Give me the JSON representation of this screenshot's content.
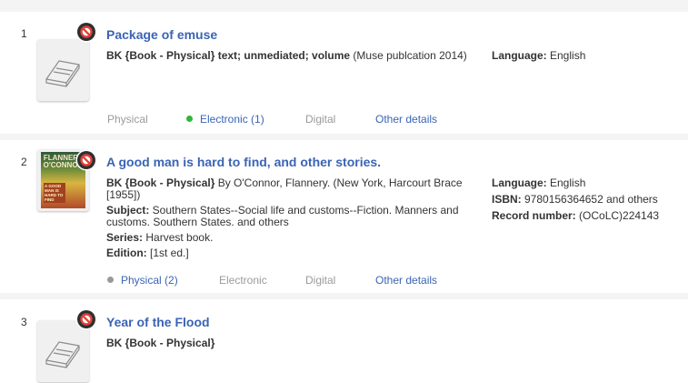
{
  "colors": {
    "link": "#3a64b4",
    "available_green": "#2db83d",
    "unavailable_grey": "#9a9a9a",
    "badge_bg": "#2f2f2f",
    "badge_ring": "#e0413a"
  },
  "results": [
    {
      "number": "1",
      "icon": "book-placeholder-icon",
      "title": "Package of emuse",
      "type_label": "BK {Book - Physical}",
      "type_rest": " text; unmediated; volume",
      "publication": " (Muse publcation 2014)",
      "language_label": "Language:",
      "language_value": " English",
      "tabs": {
        "physical": "Physical",
        "electronic": "Electronic (1)",
        "digital": "Digital",
        "other": "Other details"
      }
    },
    {
      "number": "2",
      "cover_title": "FLANNERY O'CONNOR",
      "cover_subtitle": "A GOOD MAN IS HARD TO FIND",
      "title": "A good man is hard to find, and other stories.",
      "type_label": "BK {Book - Physical}",
      "type_rest_line1": " By O'Connor, Flannery. (New York, Harcourt Brace",
      "type_rest_line2": "[1955])",
      "subject_label": "Subject:",
      "subject_line1": " Southern States--Social life and customs--Fiction. Manners and",
      "subject_line2": "customs. Southern States. and others",
      "series_label": "Series:",
      "series_value": " Harvest book.",
      "edition_label": "Edition:",
      "edition_value": " [1st ed.]",
      "language_label": "Language:",
      "language_value": " English",
      "isbn_label": "ISBN:",
      "isbn_value": " 9780156364652 and others",
      "record_label": "Record number:",
      "record_value": " (OCoLC)224143",
      "tabs": {
        "physical": "Physical (2)",
        "electronic": "Electronic",
        "digital": "Digital",
        "other": "Other details"
      }
    },
    {
      "number": "3",
      "icon": "book-placeholder-icon",
      "title": "Year of the Flood",
      "type_label": "BK {Book - Physical}"
    }
  ]
}
